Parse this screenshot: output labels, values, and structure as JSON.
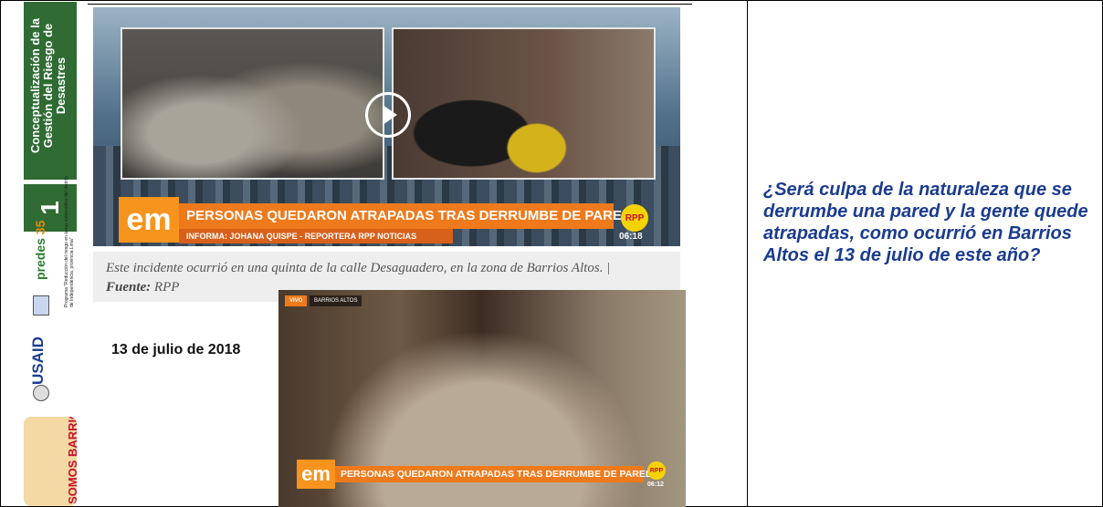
{
  "sidebar": {
    "banner_title": "Conceptualización de la Gestión del Riesgo de Desastres",
    "module_number": "1",
    "predes_logo": "predes",
    "predes_years": "35",
    "program_text": "Programa \"Reducción del riesgo en áreas vulnerables del distrito de Independencia, provincia Lima\"",
    "usaid_logo": "USAID",
    "somos_barrios_logo": "SOMOS BARRIOS"
  },
  "news_video": {
    "channel_logo": "em",
    "headline": "PERSONAS QUEDARON ATRAPADAS TRAS DERRUMBE DE PARED",
    "reporter": "INFORMA: JOHANA QUISPE - REPORTERA RPP NOTICIAS",
    "rpp_logo": "RPP",
    "time": "06:18"
  },
  "caption": {
    "text": "Este incidente ocurrió en una quinta de la calle Desaguadero, en la zona de Barrios Altos. |",
    "source_label": "Fuente:",
    "source_value": " RPP"
  },
  "date": "13 de julio de 2018",
  "second_video": {
    "live_tag": "VIVO",
    "location_tag": "BARRIOS ALTOS",
    "channel_logo": "em",
    "headline": "PERSONAS QUEDARON ATRAPADAS TRAS DERRUMBE DE PARED",
    "rpp_logo": "RPP",
    "time": "06:12"
  },
  "question": "¿Será culpa de la naturaleza que se derrumbe una pared y la gente quede atrapadas, como ocurrió en Barrios Altos el 13 de julio de este año?",
  "colors": {
    "banner_green": "#2f6b33",
    "news_orange": "#ee7a1c",
    "question_blue": "#1a3b8f"
  }
}
